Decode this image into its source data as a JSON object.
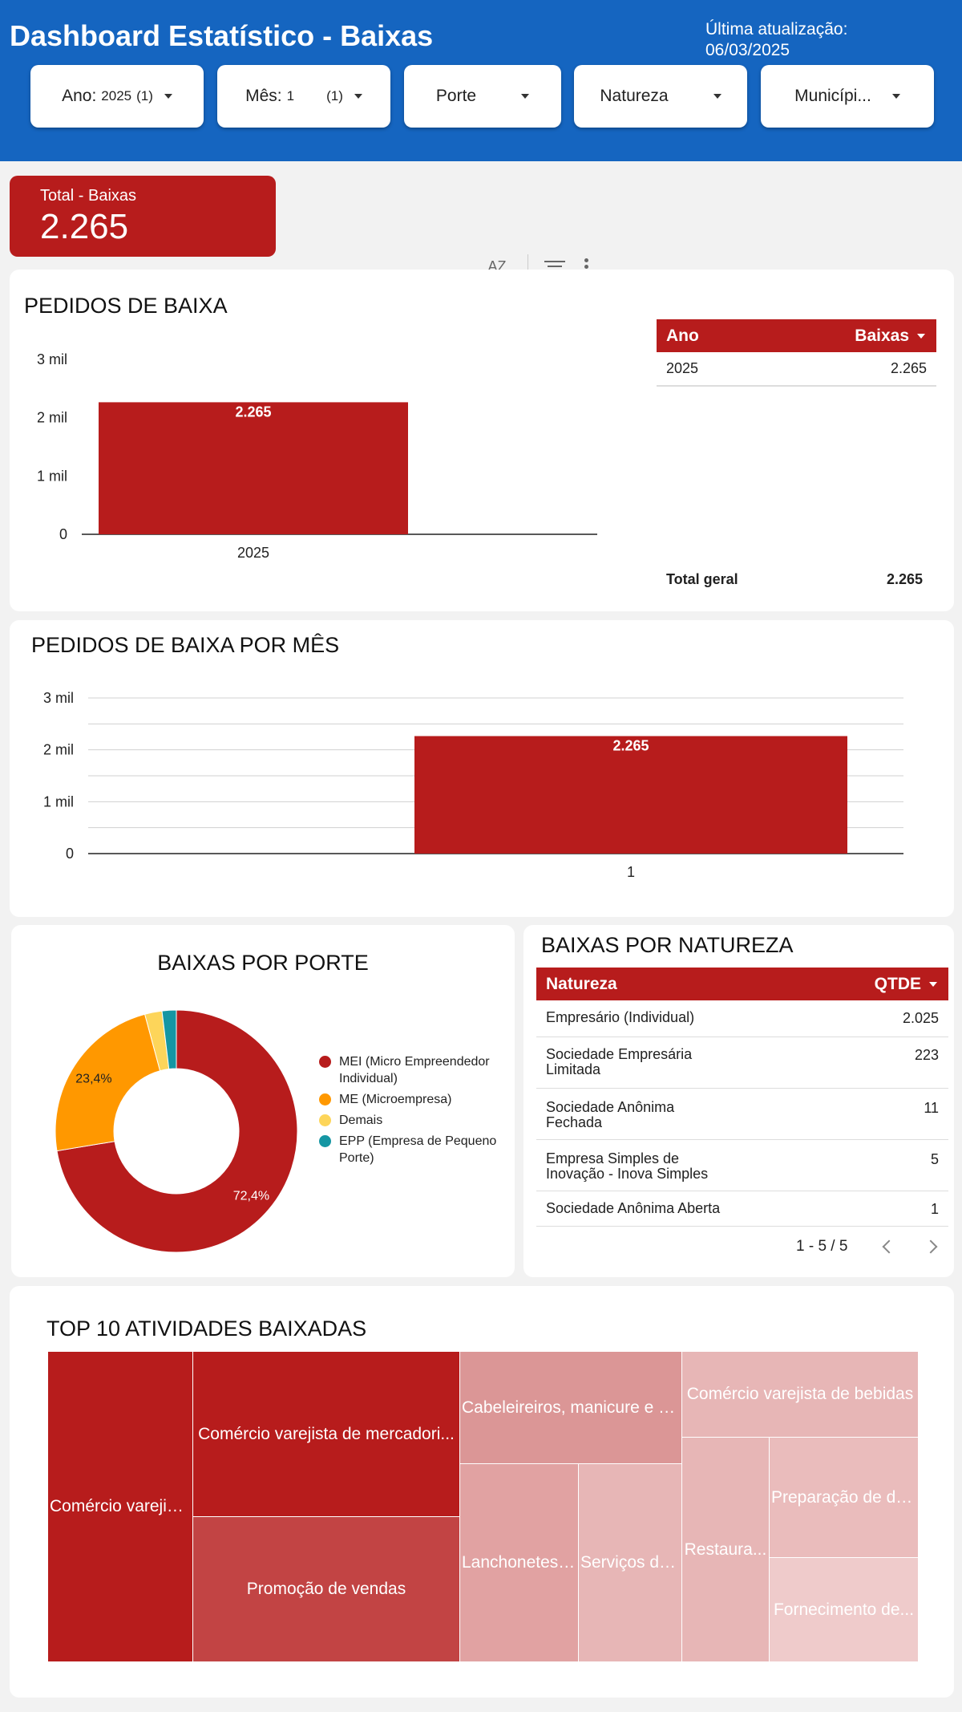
{
  "header": {
    "title": "Dashboard Estatístico - Baixas",
    "update_label": "Última atualização:",
    "update_date": "06/03/2025"
  },
  "filters": [
    {
      "label": "Ano:",
      "value": "2025",
      "count": "(1)"
    },
    {
      "label": "Mês:",
      "value": "1",
      "count": "(1)"
    },
    {
      "label": "Porte"
    },
    {
      "label": "Natureza"
    },
    {
      "label": "Municípi..."
    }
  ],
  "kpi": {
    "label": "Total - Baixas",
    "value": "2.265"
  },
  "toolbar": {
    "sort_icon_text": "AZ"
  },
  "pedidos": {
    "title": "PEDIDOS DE BAIXA",
    "table": {
      "col1": "Ano",
      "col2": "Baixas",
      "rows": [
        {
          "ano": "2025",
          "baixas": "2.265"
        }
      ],
      "total_label": "Total geral",
      "total_value": "2.265"
    }
  },
  "mes": {
    "title": "PEDIDOS DE BAIXA POR MÊS"
  },
  "porte": {
    "title": "BAIXAS POR PORTE"
  },
  "natureza": {
    "title": "BAIXAS POR NATUREZA",
    "col1": "Natureza",
    "col2": "QTDE",
    "rows": [
      {
        "name": "Empresário (Individual)",
        "qtde": "2.025"
      },
      {
        "name": "Sociedade Empresária Limitada",
        "qtde": "223"
      },
      {
        "name": "Sociedade Anônima Fechada",
        "qtde": "11"
      },
      {
        "name": "Empresa Simples de Inovação - Inova Simples",
        "qtde": "5"
      },
      {
        "name": "Sociedade Anônima Aberta",
        "qtde": "1"
      }
    ],
    "pager": "1 - 5 / 5"
  },
  "top10": {
    "title": "TOP 10 ATIVIDADES BAIXADAS",
    "items": [
      {
        "label": "Comércio varejist...",
        "color": "#b71c1c"
      },
      {
        "label": "Comércio varejista de mercadori...",
        "color": "#b71c1c"
      },
      {
        "label": "Promoção de vendas",
        "color": "#c24444"
      },
      {
        "label": "Cabeleireiros, manicure e p...",
        "color": "#db9696"
      },
      {
        "label": "Comércio varejista de bebidas",
        "color": "#e7b6b6"
      },
      {
        "label": "Lanchonetes,...",
        "color": "#e1a2a2"
      },
      {
        "label": "Serviços de...",
        "color": "#e7b6b6"
      },
      {
        "label": "Restaura...",
        "color": "#e7b6b6"
      },
      {
        "label": "Preparação de do...",
        "color": "#eabcbc"
      },
      {
        "label": "Fornecimento de...",
        "color": "#efcbcb"
      }
    ]
  },
  "colors": {
    "primary": "#1565c0",
    "accent": "#b71c1c",
    "orange": "#ff9800",
    "yellow": "#fdd55a",
    "teal": "#1596a3"
  },
  "chart_data": [
    {
      "type": "bar",
      "title": "PEDIDOS DE BAIXA",
      "categories": [
        "2025"
      ],
      "values": [
        2265
      ],
      "value_labels": [
        "2.265"
      ],
      "ylim": [
        0,
        3000
      ],
      "ytick_labels": [
        "0",
        "1 mil",
        "2 mil",
        "3 mil"
      ],
      "grid": false
    },
    {
      "type": "bar",
      "title": "PEDIDOS DE BAIXA POR MÊS",
      "categories": [
        "1"
      ],
      "values": [
        2265
      ],
      "value_labels": [
        "2.265"
      ],
      "ylim": [
        0,
        3000
      ],
      "ytick_labels": [
        "0",
        "1 mil",
        "2 mil",
        "3 mil"
      ],
      "grid": true
    },
    {
      "type": "pie",
      "title": "BAIXAS POR PORTE",
      "donut": true,
      "legend_position": "right",
      "slices": [
        {
          "name": "MEI (Micro Empreendedor Individual)",
          "value": 72.4,
          "label": "72,4%",
          "color": "#b71c1c"
        },
        {
          "name": "ME (Microempresa)",
          "value": 23.4,
          "label": "23,4%",
          "color": "#ff9800"
        },
        {
          "name": "Demais",
          "value": 2.3,
          "label": "",
          "color": "#fdd55a"
        },
        {
          "name": "EPP (Empresa de Pequeno Porte)",
          "value": 1.9,
          "label": "",
          "color": "#1596a3"
        }
      ]
    }
  ]
}
